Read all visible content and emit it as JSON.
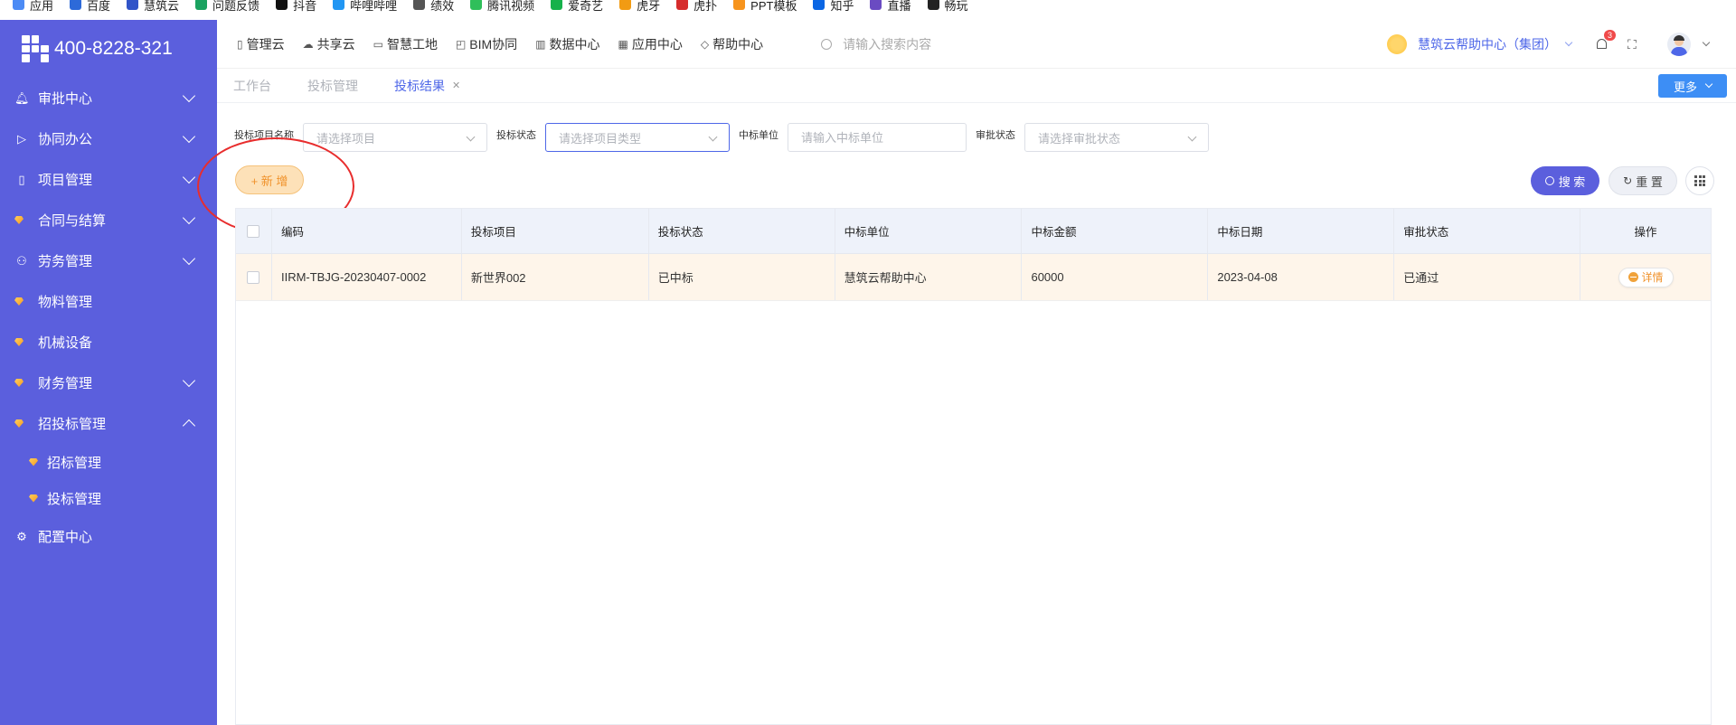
{
  "bookmarks": [
    {
      "label": "应用",
      "color": "#4c8bf5"
    },
    {
      "label": "百度",
      "color": "#2d6ad9"
    },
    {
      "label": "慧筑云",
      "color": "#3154c8"
    },
    {
      "label": "问题反馈",
      "color": "#1aa260"
    },
    {
      "label": "抖音",
      "color": "#111111"
    },
    {
      "label": "哔哩哔哩",
      "color": "#2196f3"
    },
    {
      "label": "绩效",
      "color": "#555555"
    },
    {
      "label": "腾讯视频",
      "color": "#2fbf5a"
    },
    {
      "label": "爱奇艺",
      "color": "#16b14b"
    },
    {
      "label": "虎牙",
      "color": "#f29b13"
    },
    {
      "label": "虎扑",
      "color": "#d62c2c"
    },
    {
      "label": "PPT模板",
      "color": "#f7941d"
    },
    {
      "label": "知乎",
      "color": "#0a66e4"
    },
    {
      "label": "直播",
      "color": "#6a4bc2"
    },
    {
      "label": "畅玩",
      "color": "#222222"
    }
  ],
  "sidebar": {
    "phone": "400-8228-321",
    "items": [
      {
        "label": "审批中心",
        "icon": "bell-icon",
        "glyph": "🔔︎",
        "expandable": true
      },
      {
        "label": "协同办公",
        "icon": "send-icon",
        "glyph": "▷",
        "expandable": true
      },
      {
        "label": "项目管理",
        "icon": "book-icon",
        "glyph": "▯",
        "expandable": true
      },
      {
        "label": "合同与结算",
        "icon": "gem-icon",
        "glyph": "",
        "expandable": true
      },
      {
        "label": "劳务管理",
        "icon": "user-icon",
        "glyph": "⚇",
        "expandable": true
      },
      {
        "label": "物料管理",
        "icon": "gem-icon",
        "glyph": "",
        "expandable": false
      },
      {
        "label": "机械设备",
        "icon": "gem-icon",
        "glyph": "",
        "expandable": false
      },
      {
        "label": "财务管理",
        "icon": "gem-icon",
        "glyph": "",
        "expandable": true
      },
      {
        "label": "招投标管理",
        "icon": "gem-icon",
        "glyph": "",
        "expandable": true,
        "expanded": true
      }
    ],
    "sub_items": [
      "招标管理",
      "投标管理"
    ],
    "config": {
      "label": "配置中心",
      "glyph": "⚙"
    }
  },
  "header": {
    "nav": [
      {
        "label": "管理云",
        "glyph": "▯"
      },
      {
        "label": "共享云",
        "glyph": "☁"
      },
      {
        "label": "智慧工地",
        "glyph": "▭"
      },
      {
        "label": "BIM协同",
        "glyph": "◰"
      },
      {
        "label": "数据中心",
        "glyph": "▥"
      },
      {
        "label": "应用中心",
        "glyph": "▦"
      },
      {
        "label": "帮助中心",
        "glyph": "◇"
      }
    ],
    "search_placeholder": "请输入搜索内容",
    "org_name": "慧筑云帮助中心（集团）",
    "notification_count": "3"
  },
  "tabs": [
    {
      "label": "工作台",
      "active": false
    },
    {
      "label": "投标管理",
      "active": false
    },
    {
      "label": "投标结果",
      "active": true,
      "closable": true
    }
  ],
  "more_label": "更多",
  "filters": [
    {
      "label": "投标项目名称",
      "placeholder": "请选择项目",
      "width": 204,
      "type": "select"
    },
    {
      "label": "投标状态",
      "placeholder": "请选择项目类型",
      "width": 204,
      "type": "select",
      "focused": true
    },
    {
      "label": "中标单位",
      "placeholder": "请输入中标单位",
      "width": 198,
      "type": "input"
    },
    {
      "label": "审批状态",
      "placeholder": "请选择审批状态",
      "width": 204,
      "type": "select"
    }
  ],
  "actions": {
    "add_label": "+ 新 增",
    "search_label": "搜 索",
    "reset_label": "重 置"
  },
  "table": {
    "columns": [
      "编码",
      "投标项目",
      "投标状态",
      "中标单位",
      "中标金额",
      "中标日期",
      "审批状态",
      "操作"
    ],
    "rows": [
      {
        "code": "IIRM-TBJG-20230407-0002",
        "project": "新世界002",
        "status": "已中标",
        "unit": "慧筑云帮助中心",
        "amount": "60000",
        "date": "2023-04-08",
        "approval": "已通过",
        "action": "详情"
      }
    ]
  }
}
